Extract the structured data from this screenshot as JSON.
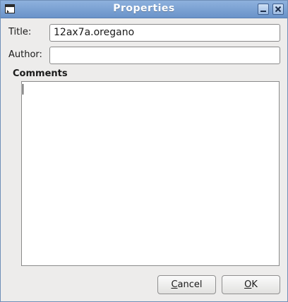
{
  "window": {
    "title": "Properties"
  },
  "titlebar_icons": {
    "app": "window-menu-icon",
    "minimize": "minimize-icon",
    "close": "close-icon"
  },
  "form": {
    "title_label": "Title:",
    "title_value": "12ax7a.oregano",
    "author_label": "Author:",
    "author_value": "",
    "comments_heading": "Comments",
    "comments_value": ""
  },
  "buttons": {
    "cancel_mnemonic": "C",
    "cancel_rest": "ancel",
    "ok_mnemonic": "O",
    "ok_rest": "K"
  }
}
